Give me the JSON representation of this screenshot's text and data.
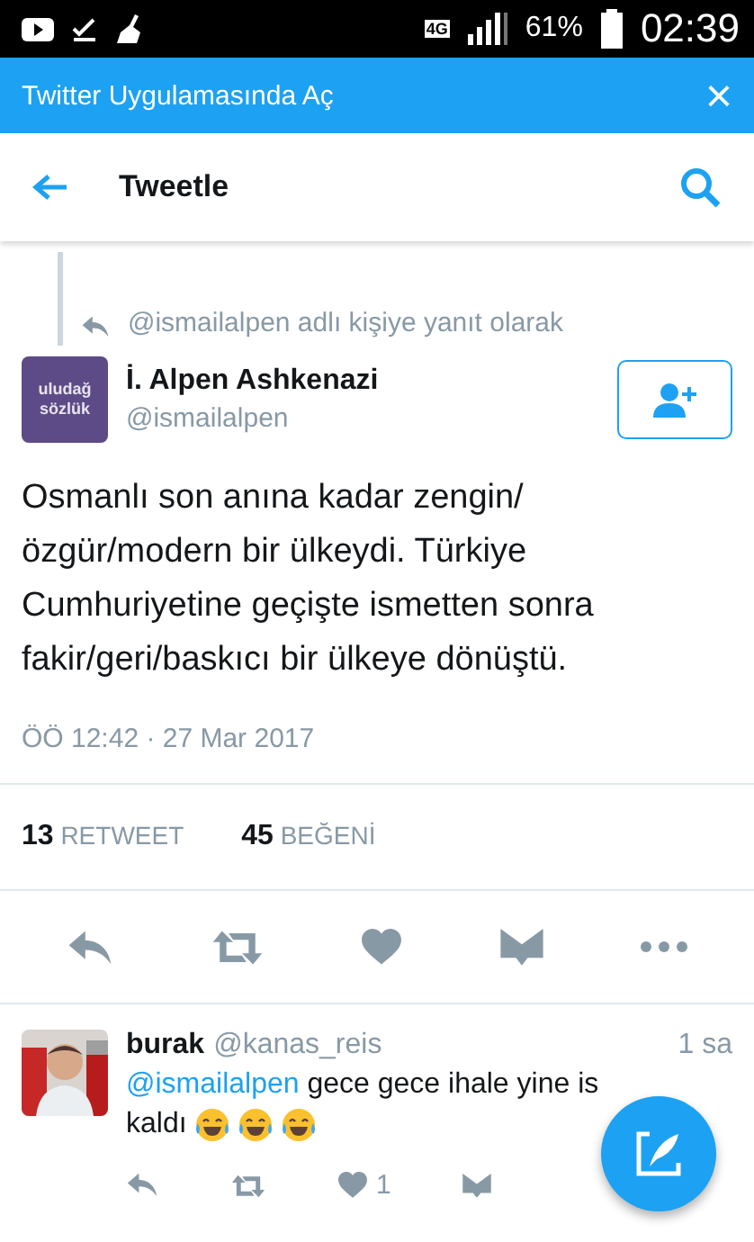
{
  "status_bar": {
    "network": "4G",
    "battery_percent": "61%",
    "time": "02:39"
  },
  "banner": {
    "text": "Twitter Uygulamasında Aç",
    "close": "×"
  },
  "header": {
    "title": "Tweetle"
  },
  "tweet": {
    "reply_context": "@ismailalpen adlı kişiye yanıt olarak",
    "avatar_text": [
      "uludağ",
      "sözlük"
    ],
    "name": "İ. Alpen Ashkenazi",
    "handle": "@ismailalpen",
    "text": "Osmanlı son anına kadar zengin/özgür/modern bir ülkeydi. Türkiye Cumhuriyetine geçişte ismetten sonra fakir/geri/baskıcı bir ülkeye dönüştü.",
    "timestamp": "ÖÖ 12:42 · 27 Mar 2017",
    "stats": [
      {
        "count": "13",
        "label": "RETWEET"
      },
      {
        "count": "45",
        "label": "BEĞENİ"
      }
    ]
  },
  "replies": [
    {
      "name": "burak",
      "handle": "@kanas_reis",
      "time": "1 sa",
      "mention": "@ismailalpen",
      "text_line_1": "gece gece ihale yine is",
      "text_line_2": "kaldı",
      "emoji": [
        {
          "kind": "tears_of_joy"
        },
        {
          "kind": "tears_of_joy"
        },
        {
          "kind": "tears_of_joy"
        }
      ],
      "like_count": "1"
    }
  ]
}
